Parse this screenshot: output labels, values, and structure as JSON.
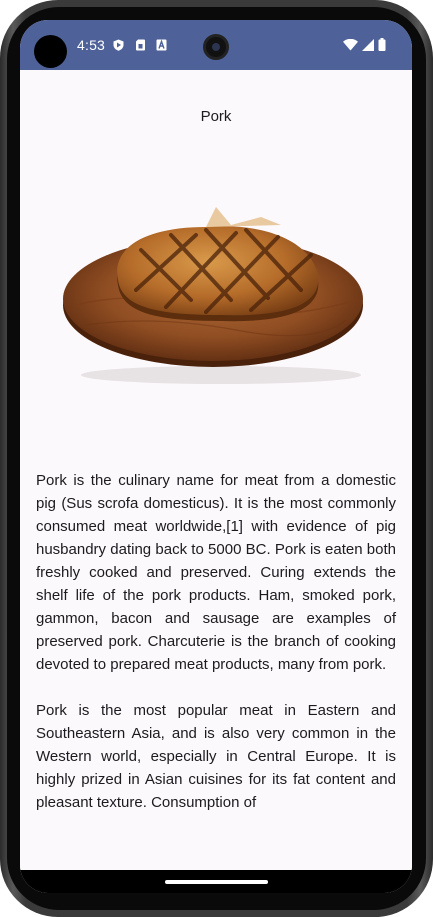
{
  "status_bar": {
    "time": "4:53",
    "notification_icons": [
      "play-protect-icon",
      "sim-card-icon",
      "font-a-icon"
    ],
    "system_icons": [
      "wifi-icon",
      "cellular-signal-icon",
      "battery-icon"
    ],
    "background_color": "#4e6299"
  },
  "page": {
    "title": "Pork",
    "image_subject": "grilled pork steak on wooden board",
    "paragraphs": [
      "Pork is the culinary name for meat from a domestic pig (Sus scrofa domesticus). It is the most commonly consumed meat worldwide,[1] with evidence of pig husbandry dating back to 5000 BC. Pork is eaten both freshly cooked and preserved. Curing extends the shelf life of the pork products. Ham, smoked pork, gammon, bacon and sausage are examples of preserved pork. Charcuterie is the branch of cooking devoted to prepared meat products, many from pork.",
      "Pork is the most popular meat in Eastern and Southeastern Asia, and is also very common in the Western world, especially in Central Europe. It is highly prized in Asian cuisines for its fat content and pleasant texture. Consumption of"
    ]
  },
  "nav_bar": {
    "home_indicator": "home-gesture-bar"
  }
}
